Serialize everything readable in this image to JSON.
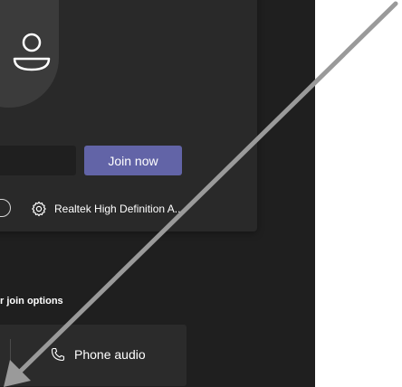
{
  "prejoin": {
    "name_input": {
      "value": "",
      "placeholder": ""
    },
    "join_button_label": "Join now",
    "audio_device_label": "Realtek High Definition A..."
  },
  "other_join_options": {
    "heading": "r join options",
    "phone_audio_label": "Phone audio"
  },
  "icons": {
    "avatar": "person-icon",
    "device_settings": "gear-icon",
    "phone_audio": "phone-icon",
    "annotation": "arrow-icon"
  },
  "colors": {
    "background": "#1f1f1f",
    "card": "#292929",
    "join_button": "#6264a7",
    "annotation_arrow": "#9a9a9a",
    "page_right": "#ffffff"
  }
}
